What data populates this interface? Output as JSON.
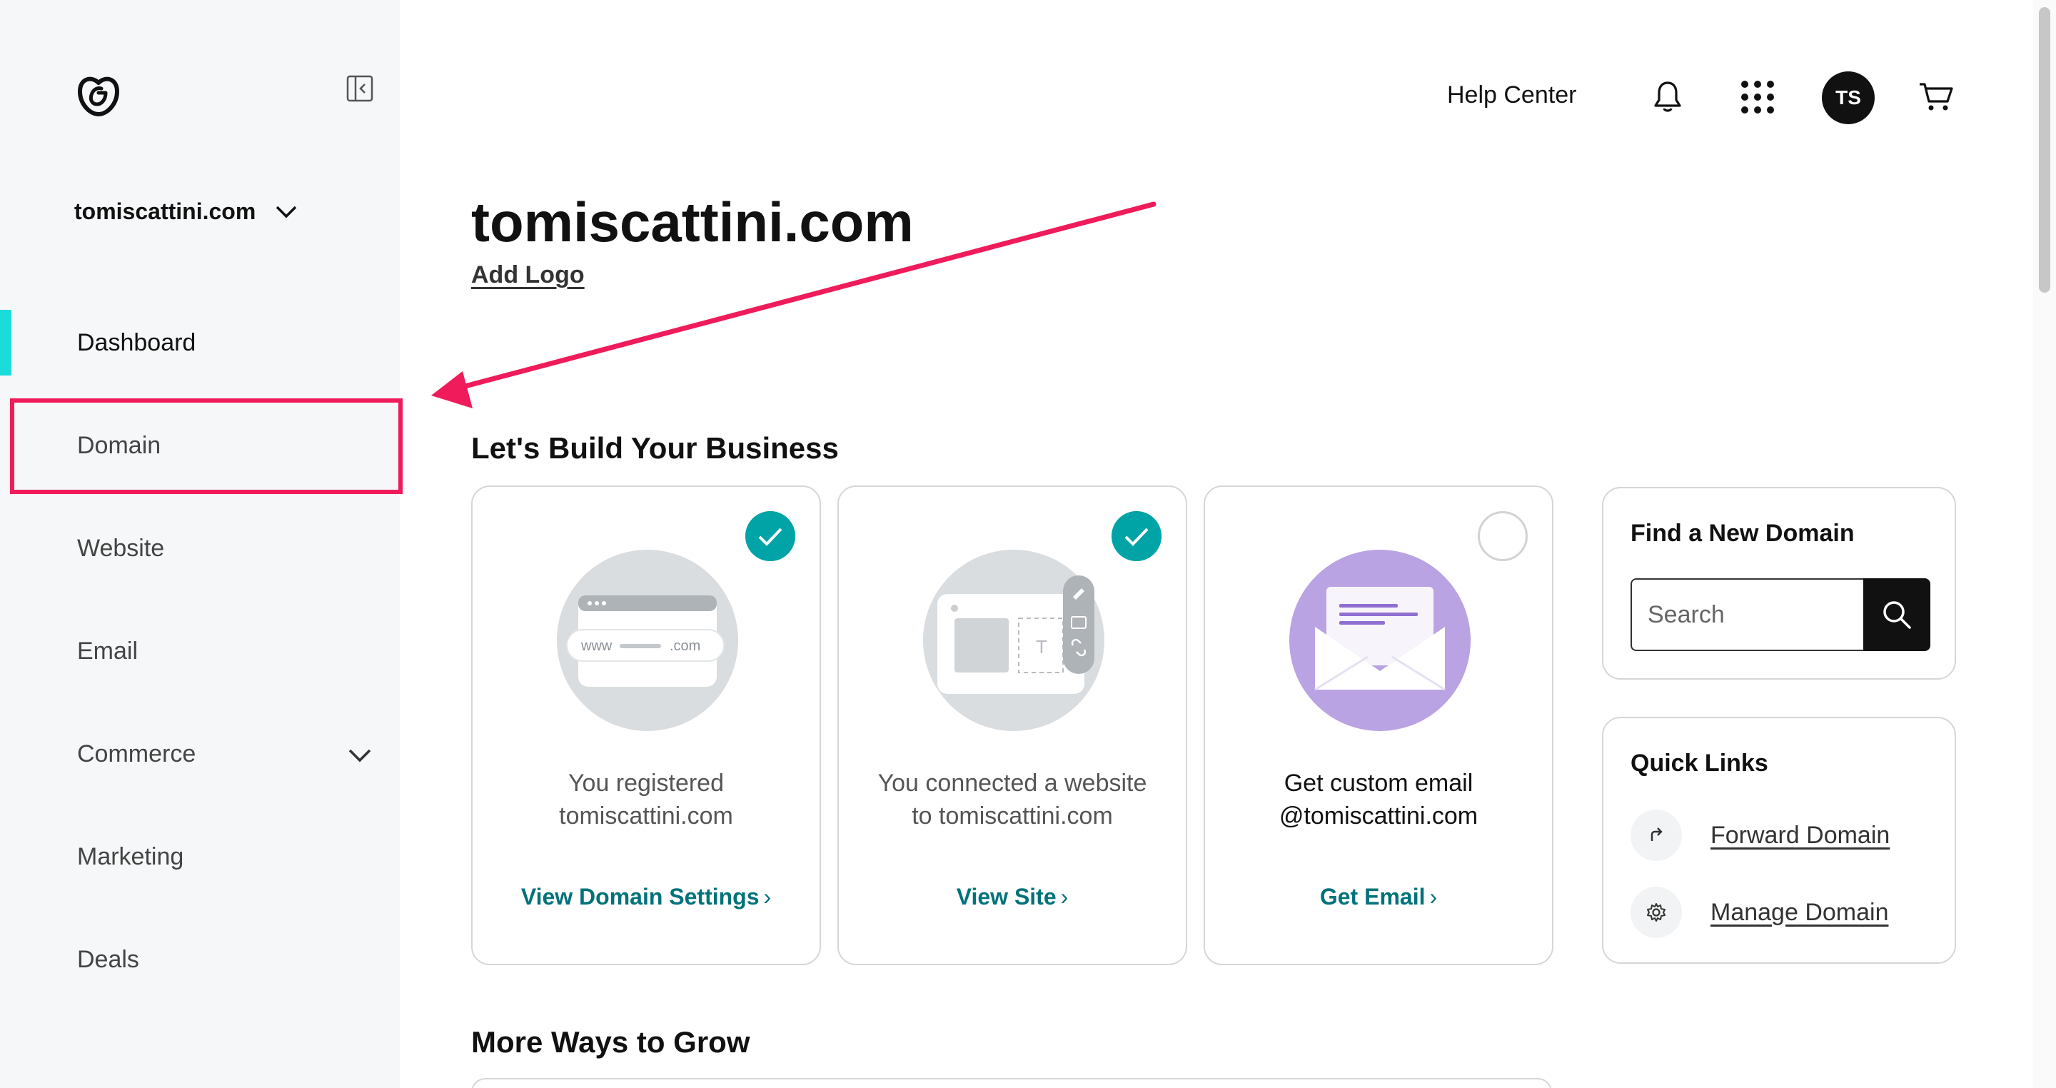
{
  "sidebar": {
    "account_name": "tomiscattini.com",
    "items": [
      {
        "label": "Dashboard",
        "active": true
      },
      {
        "label": "Domain"
      },
      {
        "label": "Website"
      },
      {
        "label": "Email"
      },
      {
        "label": "Commerce",
        "expandable": true
      },
      {
        "label": "Marketing"
      },
      {
        "label": "Deals"
      }
    ]
  },
  "header": {
    "help_label": "Help Center",
    "avatar_initials": "TS",
    "icons": [
      "bell-icon",
      "apps-grid-icon",
      "cart-icon"
    ]
  },
  "main": {
    "title": "tomiscattini.com",
    "add_logo": "Add Logo",
    "build_section_title": "Let's Build Your Business",
    "more_section_title": "More Ways to Grow",
    "cards": [
      {
        "line1": "You registered",
        "line2": "tomiscattini.com",
        "cta": "View Domain Settings",
        "done": true
      },
      {
        "line1": "You connected a website",
        "line2": "to tomiscattini.com",
        "cta": "View Site",
        "done": true
      },
      {
        "line1": "Get custom email",
        "line2": "@tomiscattini.com",
        "cta": "Get Email",
        "done": false
      }
    ],
    "domain_illustration": {
      "www": "www",
      "com": ".com"
    },
    "find_domain": {
      "title": "Find a New Domain",
      "placeholder": "Search"
    },
    "quick_links": {
      "title": "Quick Links",
      "items": [
        {
          "label": "Forward Domain",
          "icon": "forward-arrow-icon"
        },
        {
          "label": "Manage Domain",
          "icon": "gear-icon"
        }
      ]
    }
  },
  "colors": {
    "accent_teal": "#00a4a6",
    "active_indicator": "#1bdbdb",
    "link_teal": "#00727a",
    "annotation_pink": "#ef1b5a",
    "email_purple": "#b9a3e3"
  }
}
